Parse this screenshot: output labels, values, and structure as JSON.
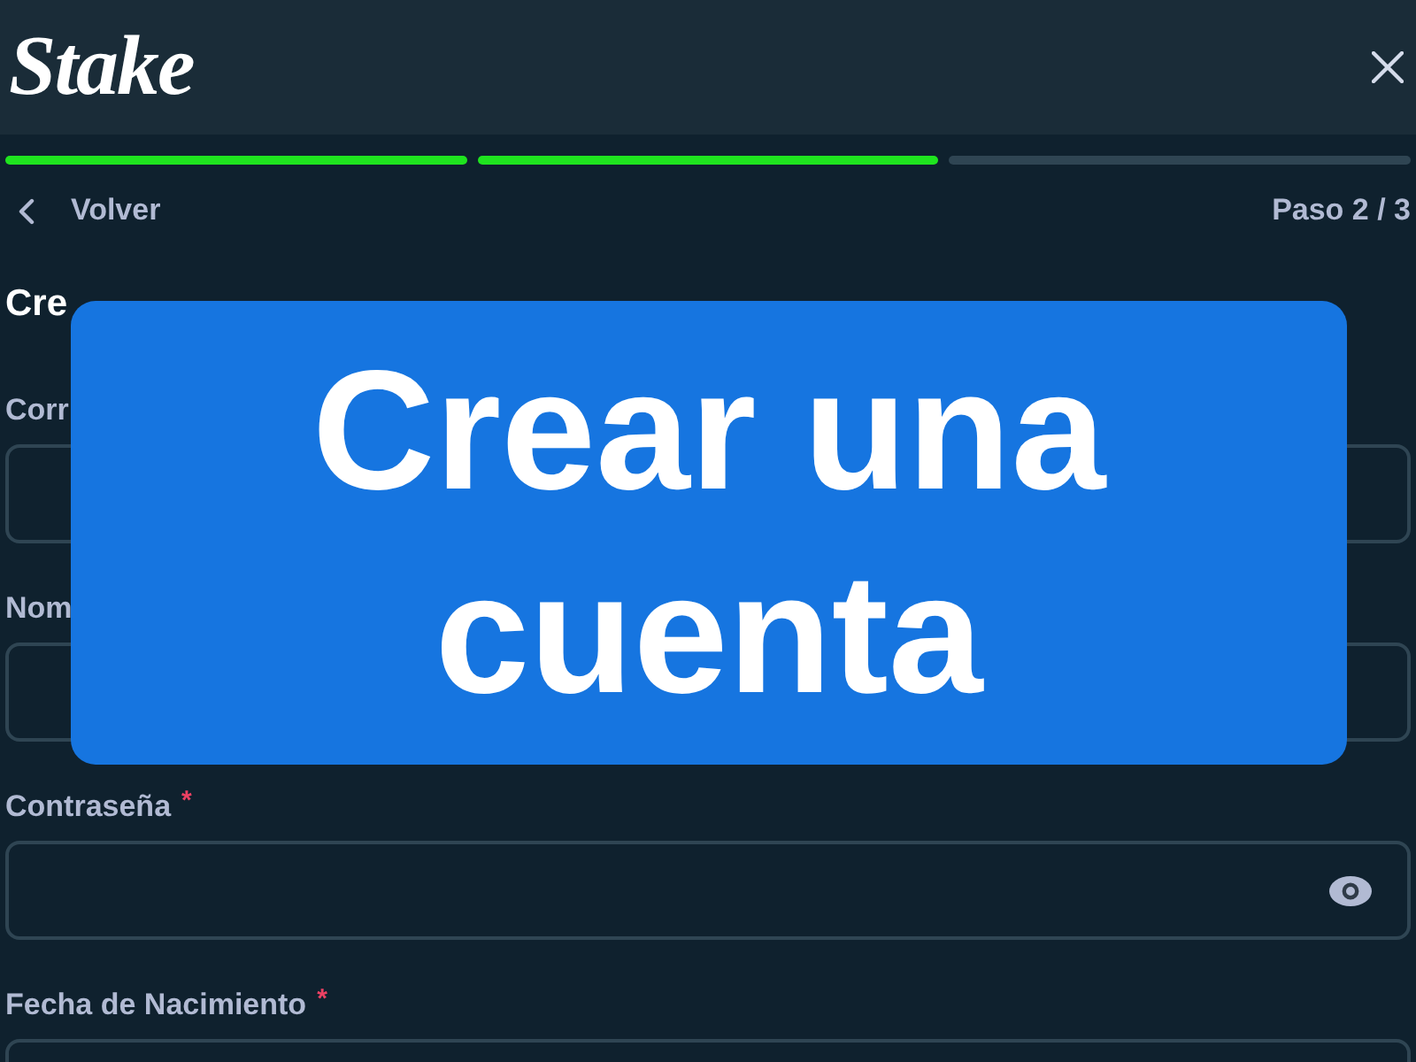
{
  "header": {
    "logo": "Stake"
  },
  "progress": [
    {
      "done": true
    },
    {
      "done": true
    },
    {
      "done": false
    }
  ],
  "nav": {
    "back": "Volver",
    "step": "Paso 2 / 3"
  },
  "heading": "Cre",
  "fields": [
    {
      "label": "Corr",
      "kind": "plain"
    },
    {
      "label": "Nom",
      "kind": "plain"
    },
    {
      "label": "Contraseña",
      "required_mark": "*",
      "kind": "password"
    },
    {
      "label": "Fecha de Nacimiento",
      "required_mark": "*",
      "kind": "plain"
    }
  ],
  "banner": {
    "text": "Crear una cuenta"
  }
}
